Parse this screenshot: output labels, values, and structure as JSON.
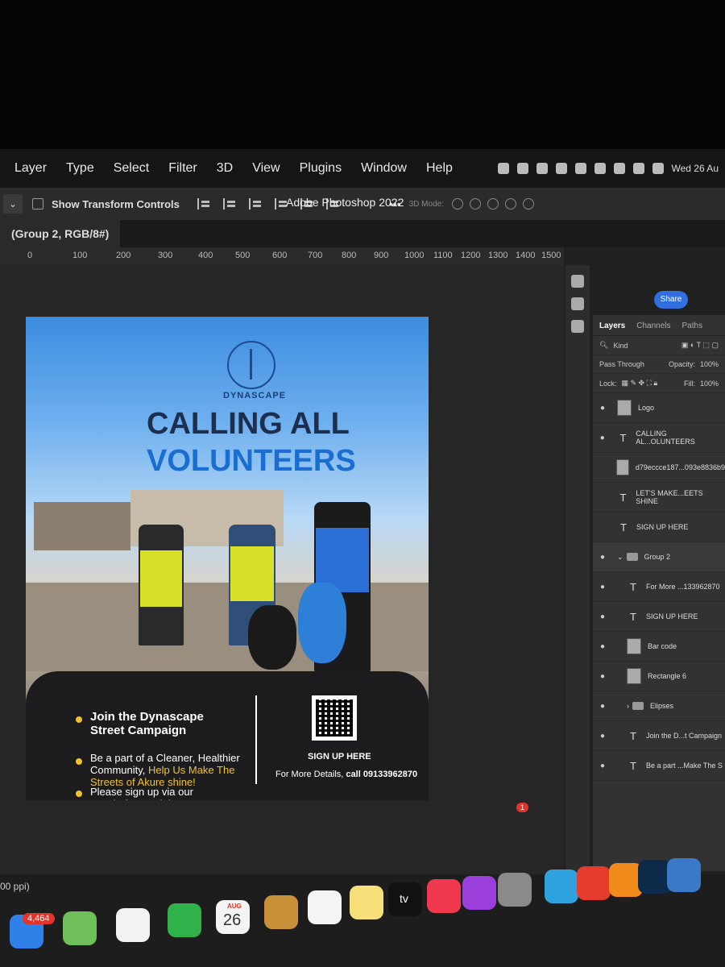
{
  "menubar": {
    "items": [
      "Layer",
      "Type",
      "Select",
      "Filter",
      "3D",
      "View",
      "Plugins",
      "Window",
      "Help"
    ],
    "clock": "Wed 26 Au"
  },
  "options": {
    "show_transform_label": "Show Transform Controls",
    "app_title": "Adobe Photoshop 2022",
    "more": "•••",
    "mode3d": "3D Mode:"
  },
  "tab": {
    "title": "(Group 2, RGB/8#)"
  },
  "ruler": {
    "ticks": [
      "0",
      "100",
      "200",
      "300",
      "400",
      "500",
      "600",
      "700",
      "800",
      "900",
      "1000",
      "1100",
      "1200",
      "1300",
      "1400",
      "1500"
    ]
  },
  "poster": {
    "brand": "DYNASCAPE",
    "headline_line1": "CALLING ALL",
    "headline_line2": "VOLUNTEERS",
    "bullet1_title": "Join the Dynascape Street Campaign",
    "bullet2_text": "Be a part of a Cleaner, Healthier Community,",
    "bullet2_highlight": "Help Us Make The Streets of Akure shine!",
    "bullet3_text": "Please sign up via our goggle form to join",
    "signup": "SIGN UP HERE",
    "details_prefix": "For More Details,",
    "details_phone": "call 09133962870"
  },
  "panel": {
    "share": "Share",
    "tabs": [
      "Layers",
      "Channels",
      "Paths"
    ],
    "kind": "Kind",
    "blend_mode": "Pass Through",
    "opacity_label": "Opacity:",
    "opacity_value": "100%",
    "lock_label": "Lock:",
    "fill_label": "Fill:",
    "fill_value": "100%",
    "layers": [
      {
        "type": "image",
        "name": "Logo"
      },
      {
        "type": "text",
        "name": "CALLING AL...OLUNTEERS"
      },
      {
        "type": "image",
        "name": "d79eccce187...093e8836b9"
      },
      {
        "type": "text",
        "name": "LET'S MAKE...EETS SHINE"
      },
      {
        "type": "text",
        "name": "SIGN UP HERE"
      },
      {
        "type": "group",
        "name": "Group 2"
      },
      {
        "type": "text",
        "name": "For More ...133962870"
      },
      {
        "type": "text",
        "name": "SIGN UP HERE"
      },
      {
        "type": "image",
        "name": "Bar code"
      },
      {
        "type": "image",
        "name": "Rectangle 6"
      },
      {
        "type": "group",
        "name": "Elipses"
      },
      {
        "type": "text",
        "name": "Join the D...t Campaign"
      },
      {
        "type": "text",
        "name": "Be a part ...Make The S"
      }
    ]
  },
  "dock": {
    "mail_badge": "4,464",
    "settings_badge": "1",
    "calendar_month": "AUG",
    "calendar_day": "26",
    "tv_label": "tv",
    "zoom": "00 ppi)"
  },
  "colors": {
    "accent_blue": "#2f6fe0",
    "headline_navy": "#1c2f4f",
    "headline_blue": "#1a6dd1",
    "highlight_yellow": "#f2c22a"
  }
}
